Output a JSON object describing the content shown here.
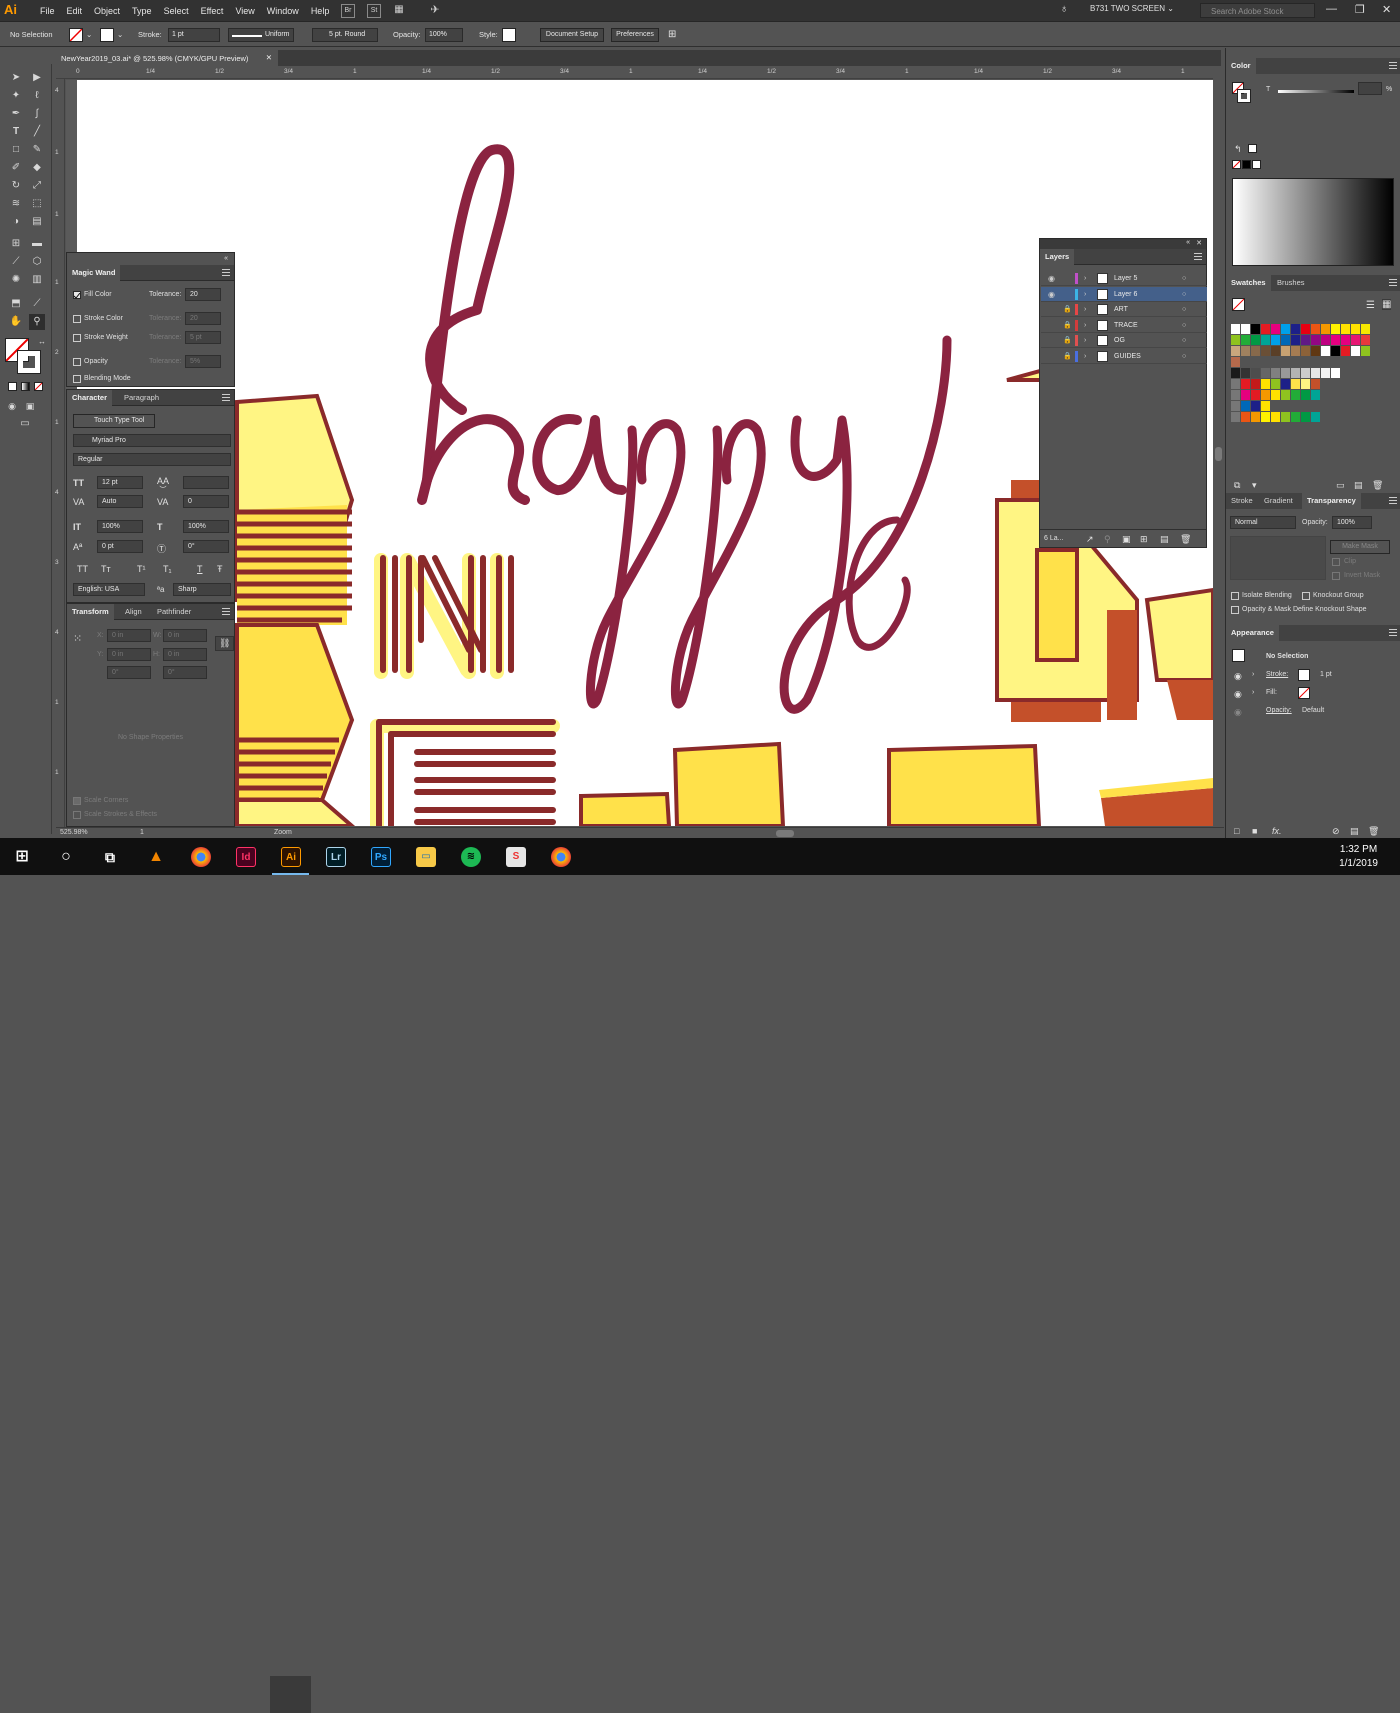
{
  "app": {
    "logo": "Ai",
    "menus": [
      "File",
      "Edit",
      "Object",
      "Type",
      "Select",
      "Effect",
      "View",
      "Window",
      "Help"
    ],
    "bridge": "Br",
    "stock": "St",
    "workspace": "B731 TWO SCREEN",
    "search_placeholder": "Search Adobe Stock"
  },
  "control": {
    "selection": "No Selection",
    "stroke_label": "Stroke:",
    "stroke_value": "1 pt",
    "profile": "Uniform",
    "brush": "5 pt. Round",
    "opacity_label": "Opacity:",
    "opacity_value": "100%",
    "style_label": "Style:",
    "doc_setup": "Document Setup",
    "preferences": "Preferences"
  },
  "document": {
    "tab": "NewYear2019_03.ai* @ 525.98% (CMYK/GPU Preview)",
    "ruler_h": [
      "0",
      "1/4",
      "1/2",
      "3/4",
      "1",
      "1/4",
      "1/2",
      "3/4",
      "1",
      "1/4",
      "1/2",
      "3/4",
      "1",
      "1/4",
      "1/2",
      "3/4",
      "1",
      "1/4"
    ],
    "ruler_v": [
      "4",
      "1",
      "1",
      "1",
      "2",
      "1",
      "4",
      "3",
      "4",
      "1",
      "1",
      "4"
    ]
  },
  "status": {
    "zoom": "525.98%",
    "artboard": "1",
    "tool": "Zoom"
  },
  "magic_wand": {
    "title": "Magic Wand",
    "fill_color": "Fill Color",
    "tolerance_label": "Tolerance:",
    "tolerance": "20",
    "stroke_color": "Stroke Color",
    "stroke_tol": "20",
    "stroke_weight": "Stroke Weight",
    "weight_tol": "5 pt",
    "opacity": "Opacity",
    "opacity_tol": "5%",
    "blending": "Blending Mode"
  },
  "character": {
    "tabs": [
      "Character",
      "Paragraph"
    ],
    "touch_type": "Touch Type Tool",
    "font": "Myriad Pro",
    "style": "Regular",
    "size": "12 pt",
    "leading": "",
    "kerning": "Auto",
    "tracking": "0",
    "vscale": "100%",
    "hscale": "100%",
    "baseline": "0 pt",
    "rotation": "0°",
    "language": "English: USA",
    "aa": "Sharp",
    "type_glyphs": [
      "TT",
      "Tт",
      "T¹",
      "T₁",
      "T",
      "Ŧ"
    ]
  },
  "transform": {
    "tabs": [
      "Transform",
      "Align",
      "Pathfinder"
    ],
    "x": "0 in",
    "y": "0 in",
    "w": "0 in",
    "h": "0 in",
    "angle": "0°",
    "shear": "0°",
    "no_shape": "No Shape Properties",
    "scale_corners": "Scale Corners",
    "scale_strokes": "Scale Strokes & Effects"
  },
  "layers": {
    "title": "Layers",
    "items": [
      {
        "name": "Layer 5",
        "color": "#c050c8",
        "visible": true,
        "locked": false,
        "selected": false
      },
      {
        "name": "Layer 6",
        "color": "#3cb4e6",
        "visible": true,
        "locked": false,
        "selected": true
      },
      {
        "name": "ART",
        "color": "#e64646",
        "visible": false,
        "locked": true,
        "selected": false
      },
      {
        "name": "TRACE",
        "color": "#d23c3c",
        "visible": false,
        "locked": true,
        "selected": false
      },
      {
        "name": "OG",
        "color": "#e05050",
        "visible": false,
        "locked": true,
        "selected": false
      },
      {
        "name": "GUIDES",
        "color": "#4a6fe0",
        "visible": false,
        "locked": true,
        "selected": false
      }
    ],
    "count": "6 La..."
  },
  "color_panel": {
    "title": "Color",
    "channel": "T",
    "percent": "%"
  },
  "swatches": {
    "tabs": [
      "Swatches",
      "Brushes"
    ]
  },
  "transparency": {
    "tabs": [
      "Stroke",
      "Gradient",
      "Transparency"
    ],
    "mode": "Normal",
    "opacity_label": "Opacity:",
    "opacity": "100%",
    "make_mask": "Make Mask",
    "clip": "Clip",
    "invert": "Invert Mask",
    "isolate": "Isolate Blending",
    "knockout": "Knockout Group",
    "define": "Opacity & Mask Define Knockout Shape"
  },
  "appearance": {
    "title": "Appearance",
    "selection": "No Selection",
    "stroke_label": "Stroke:",
    "stroke_value": "1 pt",
    "fill_label": "Fill:",
    "opacity_label": "Opacity:",
    "opacity_value": "Default"
  },
  "taskbar": {
    "time": "1:32 PM",
    "date": "1/1/2019",
    "apps": [
      "Id",
      "Ai",
      "Lr",
      "Ps"
    ]
  },
  "artwork": {
    "script_text": "happy",
    "block_text": "INI",
    "colors": {
      "maroon": "#8b2340",
      "yellow": "#ffe14a",
      "pale": "#fff583",
      "rust": "#c4502a",
      "dark": "#8a2a2a"
    }
  }
}
